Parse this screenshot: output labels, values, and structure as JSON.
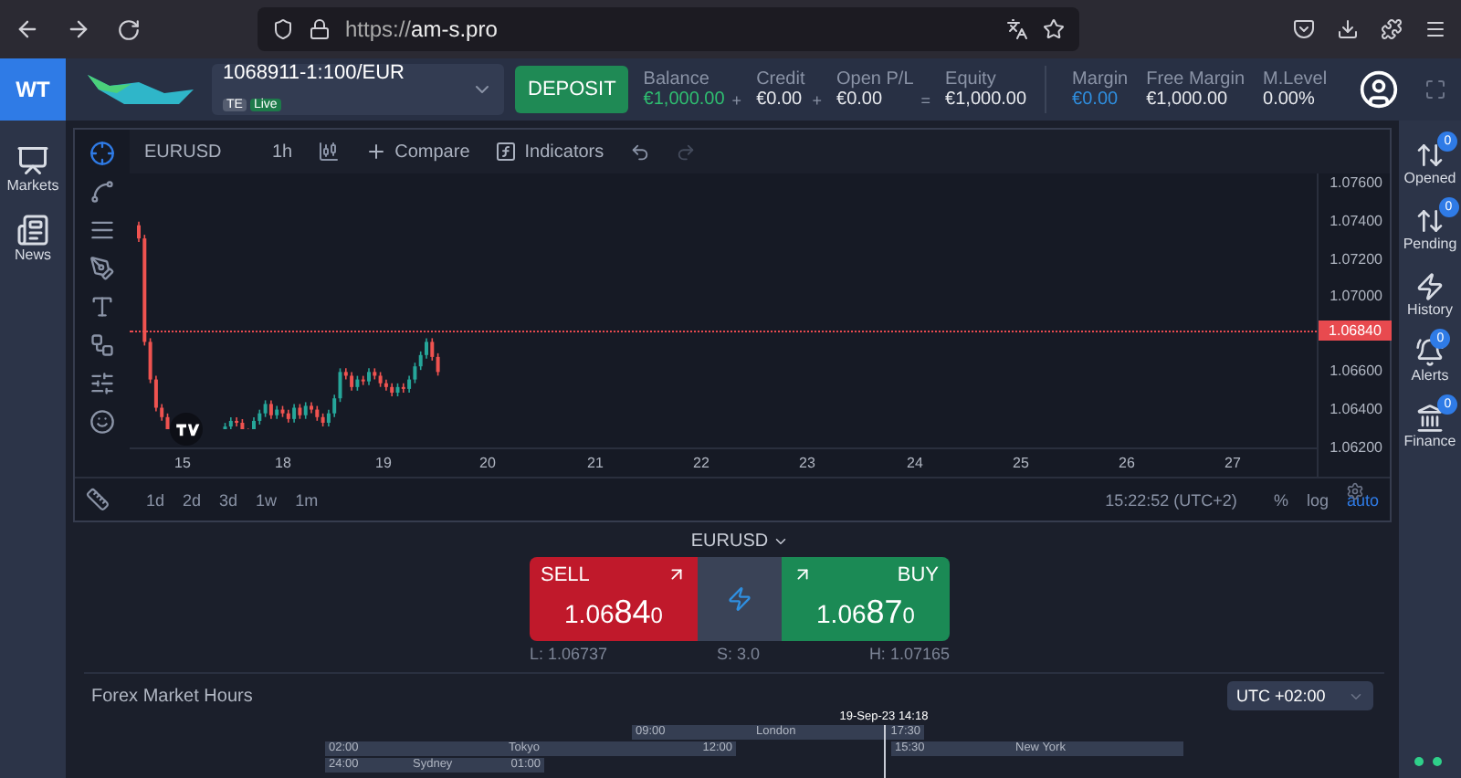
{
  "browser": {
    "url_prefix": "https://",
    "url_domain": "am-s.pro"
  },
  "header": {
    "logo_text": "WT",
    "account": {
      "number": "1068911-1:100/EUR",
      "tag": "TE",
      "mode": "Live"
    },
    "deposit_button": "DEPOSIT",
    "stats": [
      {
        "label": "Balance",
        "value": "€1,000.00",
        "color": "#2fbf71",
        "operator": "+"
      },
      {
        "label": "Credit",
        "value": "€0.00",
        "color": "#e8eaee",
        "operator": "+"
      },
      {
        "label": "Open P/L",
        "value": "€0.00",
        "color": "#e8eaee",
        "operator": "="
      },
      {
        "label": "Equity",
        "value": "€1,000.00",
        "color": "#e8eaee"
      }
    ],
    "margin_stats": [
      {
        "label": "Margin",
        "value": "€0.00",
        "color": "#2f8fe0"
      },
      {
        "label": "Free Margin",
        "value": "€1,000.00",
        "color": "#e8eaee"
      },
      {
        "label": "M.Level",
        "value": "0.00%",
        "color": "#e8eaee"
      }
    ]
  },
  "left_sidebar": {
    "items": [
      {
        "label": "Markets"
      },
      {
        "label": "News"
      }
    ]
  },
  "right_sidebar": {
    "items": [
      {
        "label": "Opened",
        "badge": "0"
      },
      {
        "label": "Pending",
        "badge": "0"
      },
      {
        "label": "History"
      },
      {
        "label": "Alerts",
        "badge": "0"
      },
      {
        "label": "Finance",
        "badge": "0"
      }
    ]
  },
  "chart": {
    "symbol": "EURUSD",
    "interval": "1h",
    "compare": "Compare",
    "indicators": "Indicators",
    "price_ticks": [
      "1.07600",
      "1.07400",
      "1.07200",
      "1.07000",
      "1.06600",
      "1.06400",
      "1.06200"
    ],
    "current_price": "1.06840",
    "date_ticks": [
      "15",
      "18",
      "19",
      "20",
      "21",
      "22",
      "23",
      "24",
      "25",
      "26",
      "27"
    ],
    "ranges": [
      "1d",
      "2d",
      "3d",
      "1w",
      "1m"
    ],
    "clock": "15:22:52 (UTC+2)",
    "scale_options": [
      {
        "label": "%",
        "selected": false
      },
      {
        "label": "log",
        "selected": false
      },
      {
        "label": "auto",
        "selected": true
      }
    ]
  },
  "trade": {
    "symbol": "EURUSD",
    "sell": {
      "label": "SELL",
      "price": "1.06840"
    },
    "buy": {
      "label": "BUY",
      "price": "1.06870"
    },
    "low": "L: 1.06737",
    "spread": "S: 3.0",
    "high": "H: 1.07165"
  },
  "market_hours": {
    "title": "Forex Market Hours",
    "timezone": "UTC +02:00",
    "now": "19-Sep-23 14:18",
    "sessions": [
      {
        "name": "London",
        "open": "09:00",
        "close": "17:30"
      },
      {
        "name": "Tokyo",
        "open": "02:00",
        "close": "12:00"
      },
      {
        "name": "New York",
        "open": "15:30"
      },
      {
        "name": "Sydney",
        "open": "24:00",
        "close": "01:00"
      }
    ]
  }
}
